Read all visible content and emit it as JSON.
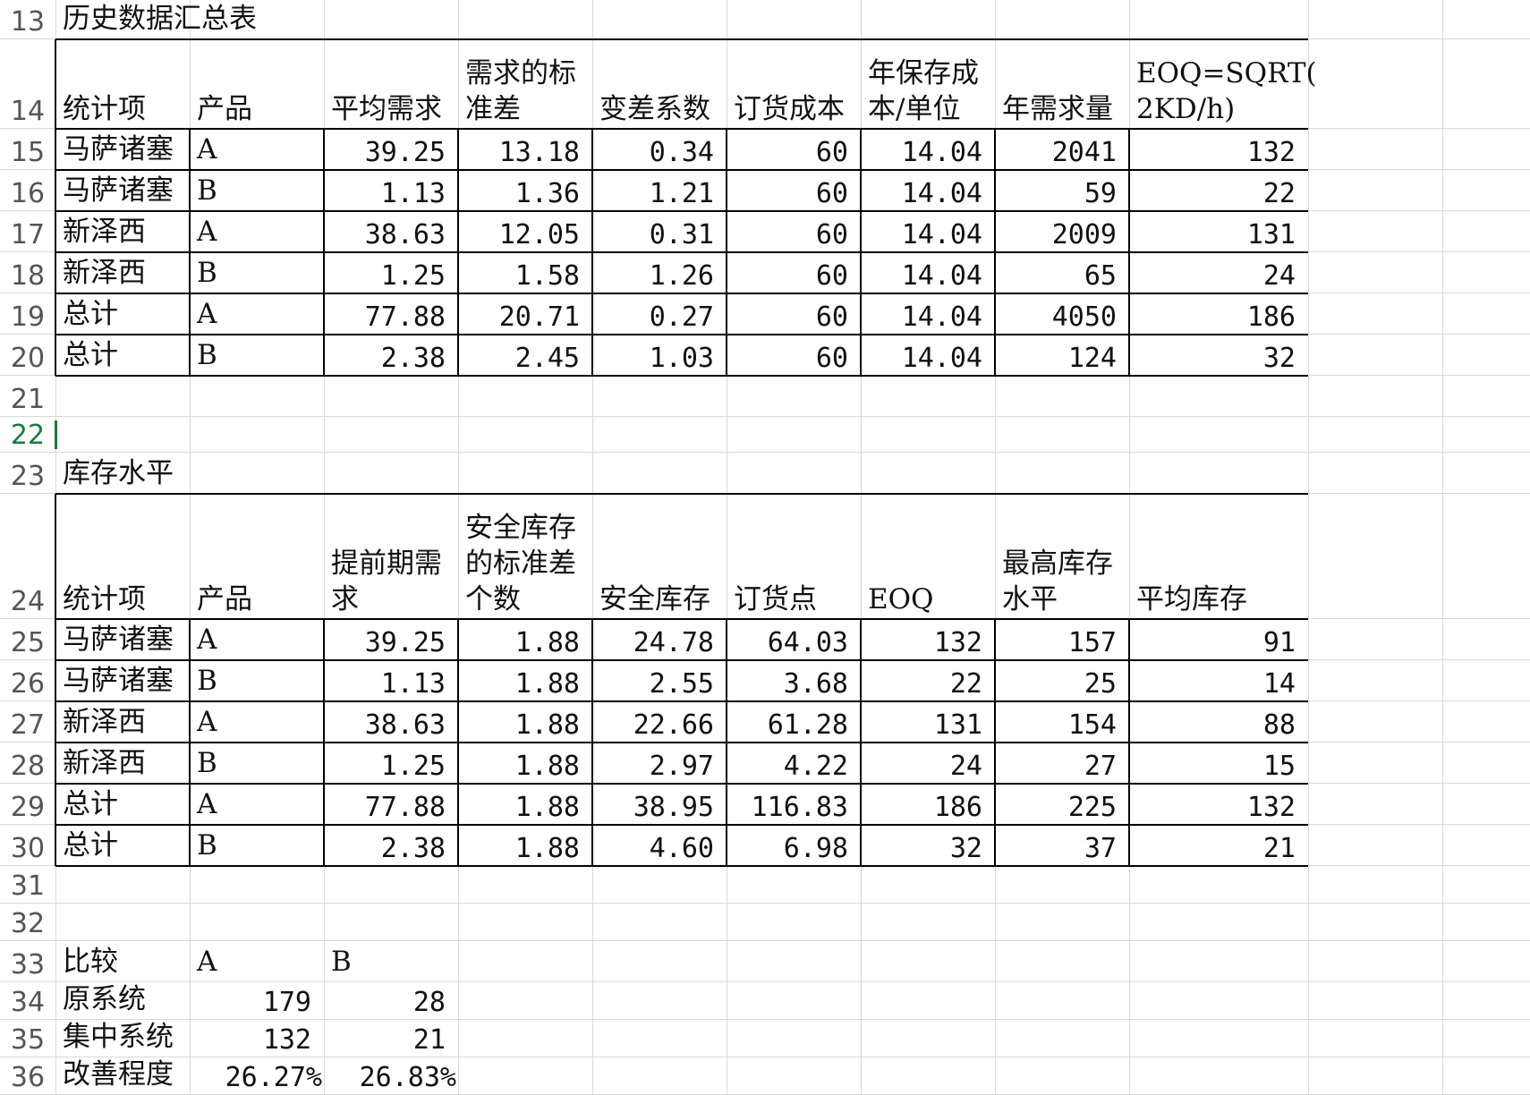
{
  "row_numbers": [
    13,
    14,
    15,
    16,
    17,
    18,
    19,
    20,
    21,
    22,
    23,
    24,
    25,
    26,
    27,
    28,
    29,
    30,
    31,
    32,
    33,
    34,
    35,
    36
  ],
  "active_row": 22,
  "colors": {
    "grid": "#d9d9d9",
    "border": "#000000",
    "row_number_text": "#555555",
    "active_row_number": "#1a7a3a",
    "cell_cursor": "#1a7a3a"
  },
  "table1": {
    "title": "历史数据汇总表",
    "headers": [
      "统计项",
      "产品",
      "平均需求",
      "需求的标\n准差",
      "变差系数",
      "订货成本",
      "年保存成\n本/单位",
      "年需求量",
      "EOQ=SQRT(\n2KD/h)"
    ],
    "rows": [
      [
        "马萨诸塞",
        "A",
        "39.25",
        "13.18",
        "0.34",
        "60",
        "14.04",
        "2041",
        "132"
      ],
      [
        "马萨诸塞",
        "B",
        "1.13",
        "1.36",
        "1.21",
        "60",
        "14.04",
        "59",
        "22"
      ],
      [
        "新泽西",
        "A",
        "38.63",
        "12.05",
        "0.31",
        "60",
        "14.04",
        "2009",
        "131"
      ],
      [
        "新泽西",
        "B",
        "1.25",
        "1.58",
        "1.26",
        "60",
        "14.04",
        "65",
        "24"
      ],
      [
        "总计",
        "A",
        "77.88",
        "20.71",
        "0.27",
        "60",
        "14.04",
        "4050",
        "186"
      ],
      [
        "总计",
        "B",
        "2.38",
        "2.45",
        "1.03",
        "60",
        "14.04",
        "124",
        "32"
      ]
    ]
  },
  "table2": {
    "title": "库存水平",
    "headers": [
      "统计项",
      "产品",
      "提前期需\n求",
      "安全库存\n的标准差\n个数",
      "安全库存",
      "订货点",
      "EOQ",
      "最高库存\n水平",
      "平均库存"
    ],
    "rows": [
      [
        "马萨诸塞",
        "A",
        "39.25",
        "1.88",
        "24.78",
        "64.03",
        "132",
        "157",
        "91"
      ],
      [
        "马萨诸塞",
        "B",
        "1.13",
        "1.88",
        "2.55",
        "3.68",
        "22",
        "25",
        "14"
      ],
      [
        "新泽西",
        "A",
        "38.63",
        "1.88",
        "22.66",
        "61.28",
        "131",
        "154",
        "88"
      ],
      [
        "新泽西",
        "B",
        "1.25",
        "1.88",
        "2.97",
        "4.22",
        "24",
        "27",
        "15"
      ],
      [
        "总计",
        "A",
        "77.88",
        "1.88",
        "38.95",
        "116.83",
        "186",
        "225",
        "132"
      ],
      [
        "总计",
        "B",
        "2.38",
        "1.88",
        "4.60",
        "6.98",
        "32",
        "37",
        "21"
      ]
    ]
  },
  "comparison": {
    "header": [
      "比较",
      "A",
      "B"
    ],
    "rows": [
      [
        "原系统",
        "179",
        "28"
      ],
      [
        "集中系统",
        "132",
        "21"
      ],
      [
        "改善程度",
        "26.27%",
        "26.83%"
      ]
    ]
  }
}
